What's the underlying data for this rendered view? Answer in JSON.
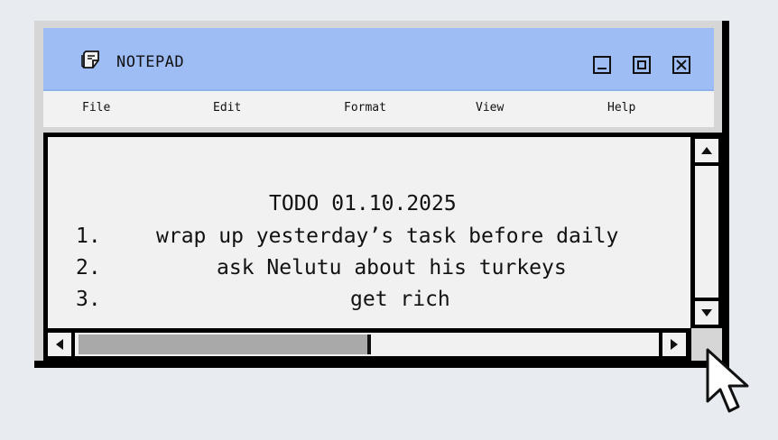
{
  "window": {
    "title": "NOTEPAD",
    "title_icon": "notepad-icon",
    "controls": [
      "minimize-icon",
      "maximize-icon",
      "close-icon"
    ]
  },
  "menu": {
    "file": "File",
    "edit": "Edit",
    "format": "Format",
    "view": "View",
    "help": "Help"
  },
  "document": {
    "heading": "TODO 01.10.2025",
    "items": [
      {
        "number": "1.",
        "text": "wrap up yesterday’s task before daily"
      },
      {
        "number": "2.",
        "text": "ask Nelutu about his turkeys"
      },
      {
        "number": "3.",
        "text": "get rich"
      }
    ]
  },
  "scrollbars": {
    "horizontal_thumb_fraction": 0.5,
    "icons": [
      "scroll-up-icon",
      "scroll-down-icon",
      "scroll-left-icon",
      "scroll-right-icon"
    ]
  },
  "pointer": "mouse-pointer-icon",
  "colors": {
    "background": "#e8ebf0",
    "titlebar": "#9fbdf5",
    "menubar": "#f2f2f2",
    "content": "#f1f1f1",
    "frame": "#d6d6d6",
    "border": "#000000",
    "thumb": "#a9a9a9"
  }
}
